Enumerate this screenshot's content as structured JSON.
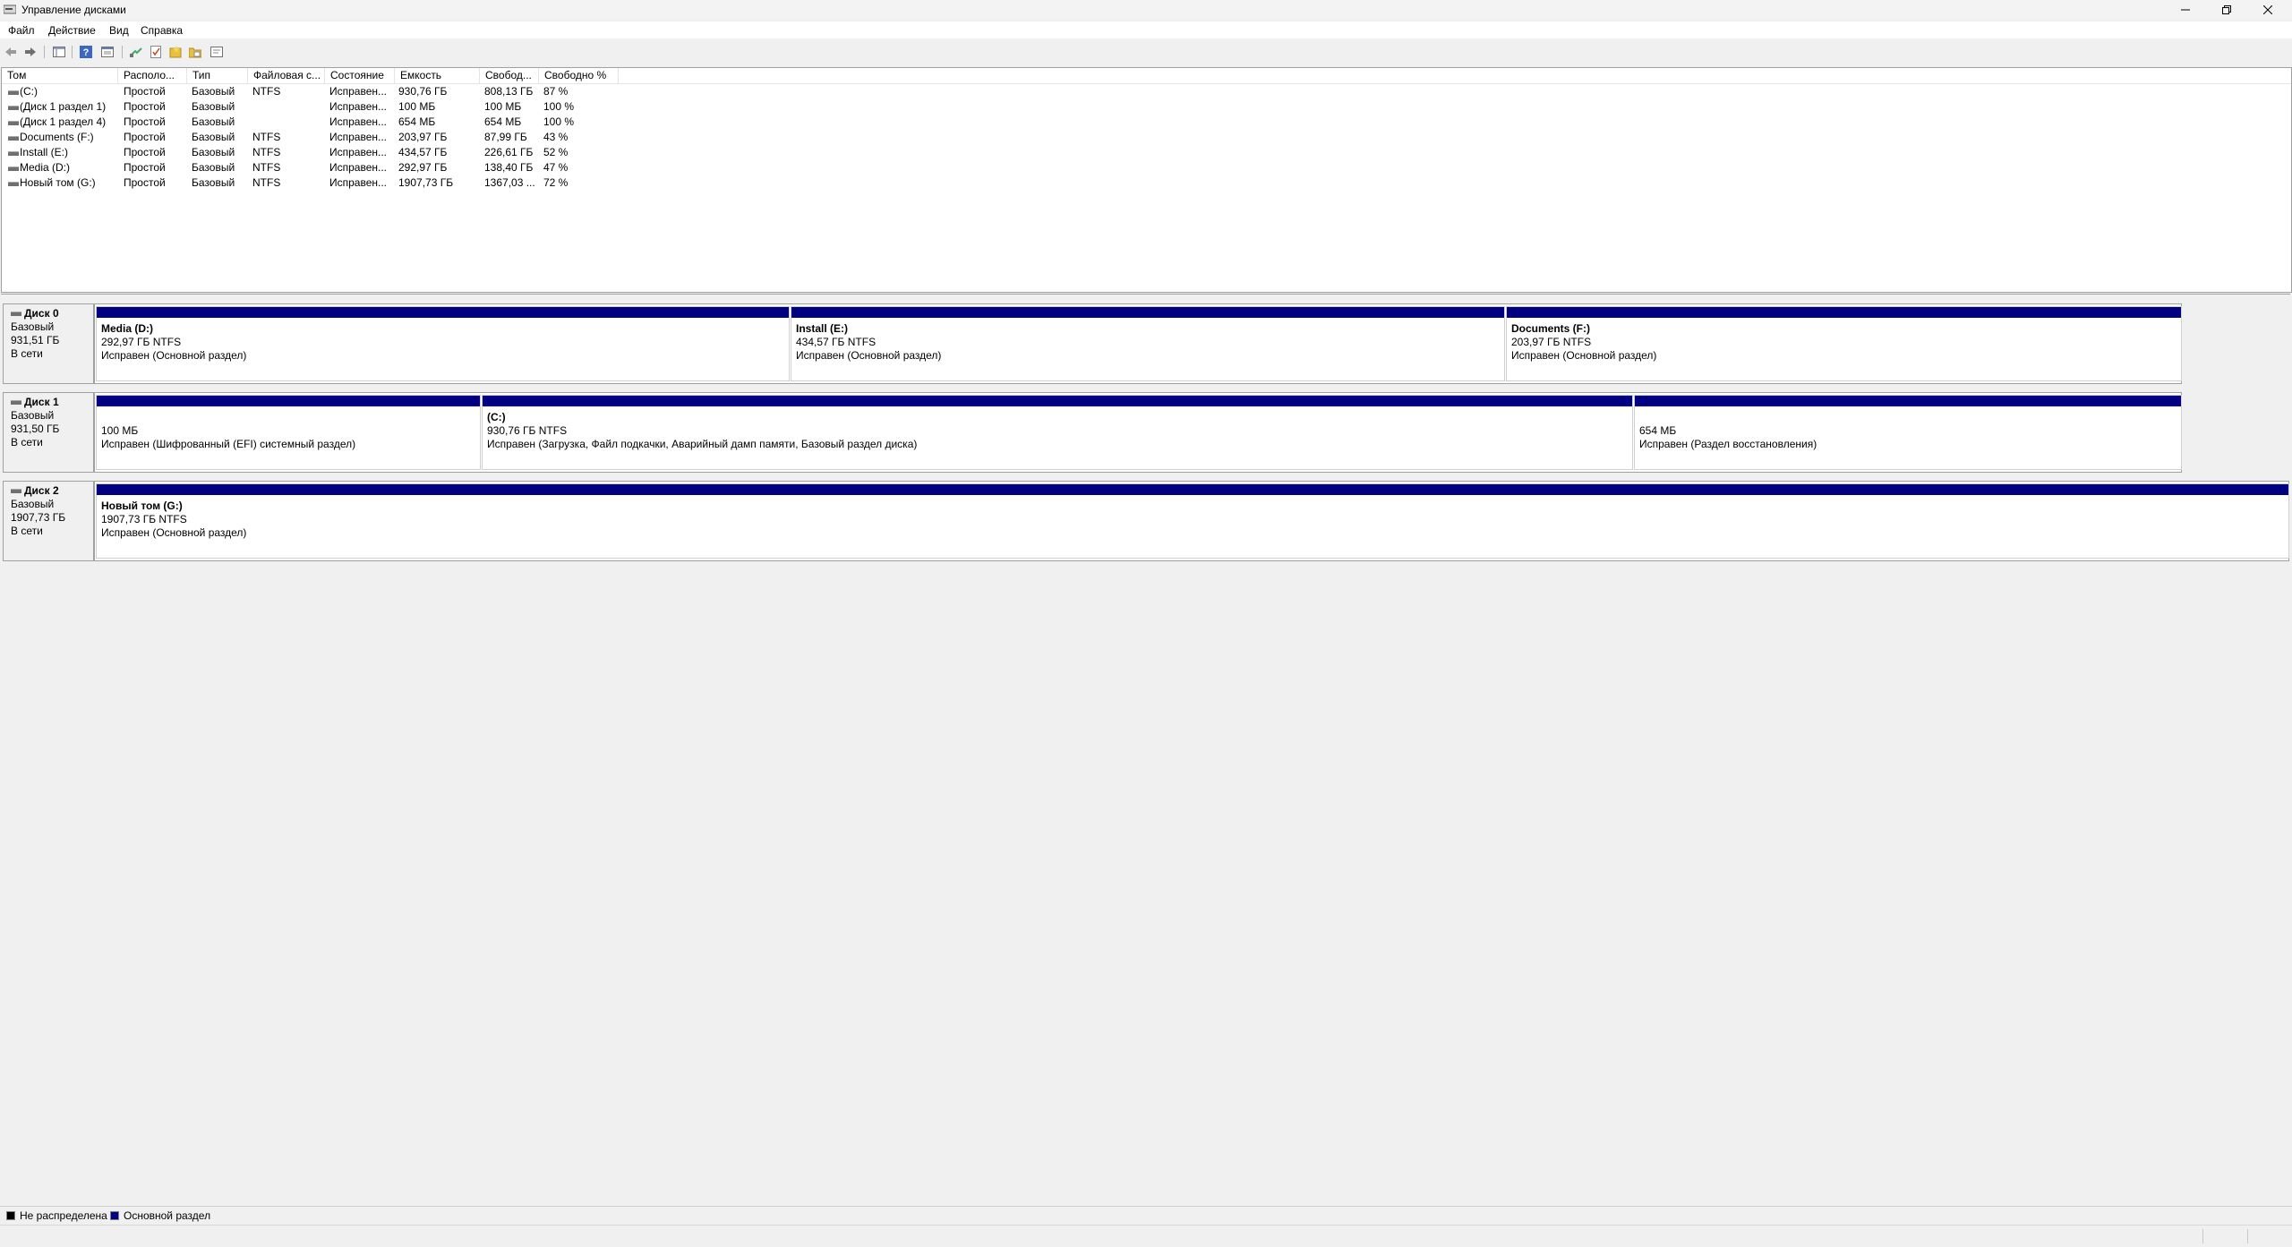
{
  "window": {
    "title": "Управление дисками"
  },
  "menu": [
    "Файл",
    "Действие",
    "Вид",
    "Справка"
  ],
  "toolbar": {
    "icons": [
      "back-icon",
      "forward-icon",
      "console-tree-icon",
      "help-icon",
      "properties-icon",
      "connect-icon",
      "check-icon",
      "new-icon",
      "folder-icon",
      "export-icon"
    ]
  },
  "volume_list": {
    "columns": [
      "Том",
      "Располо...",
      "Тип",
      "Файловая с...",
      "Состояние",
      "Емкость",
      "Свобод...",
      "Свободно %"
    ],
    "rows": [
      [
        "(C:)",
        "Простой",
        "Базовый",
        "NTFS",
        "Исправен...",
        "930,76 ГБ",
        "808,13 ГБ",
        "87 %"
      ],
      [
        "(Диск 1 раздел 1)",
        "Простой",
        "Базовый",
        "",
        "Исправен...",
        "100 МБ",
        "100 МБ",
        "100 %"
      ],
      [
        "(Диск 1 раздел 4)",
        "Простой",
        "Базовый",
        "",
        "Исправен...",
        "654 МБ",
        "654 МБ",
        "100 %"
      ],
      [
        "Documents (F:)",
        "Простой",
        "Базовый",
        "NTFS",
        "Исправен...",
        "203,97 ГБ",
        "87,99 ГБ",
        "43 %"
      ],
      [
        "Install (E:)",
        "Простой",
        "Базовый",
        "NTFS",
        "Исправен...",
        "434,57 ГБ",
        "226,61 ГБ",
        "52 %"
      ],
      [
        "Media (D:)",
        "Простой",
        "Базовый",
        "NTFS",
        "Исправен...",
        "292,97 ГБ",
        "138,40 ГБ",
        "47 %"
      ],
      [
        "Новый том (G:)",
        "Простой",
        "Базовый",
        "NTFS",
        "Исправен...",
        "1907,73 ГБ",
        "1367,03 ...",
        "72 %"
      ]
    ]
  },
  "disks": [
    {
      "name": "Диск 0",
      "type": "Базовый",
      "size": "931,51 ГБ",
      "status": "В сети",
      "partitions": [
        {
          "name": "Media  (D:)",
          "size": "292,97 ГБ NTFS",
          "status": "Исправен (Основной раздел)"
        },
        {
          "name": "Install  (E:)",
          "size": "434,57 ГБ NTFS",
          "status": "Исправен (Основной раздел)"
        },
        {
          "name": "Documents  (F:)",
          "size": "203,97 ГБ NTFS",
          "status": "Исправен (Основной раздел)"
        }
      ]
    },
    {
      "name": "Диск 1",
      "type": "Базовый",
      "size": "931,50 ГБ",
      "status": "В сети",
      "partitions": [
        {
          "name": "",
          "size": "100 МБ",
          "status": "Исправен (Шифрованный (EFI) системный раздел)"
        },
        {
          "name": "(C:)",
          "size": "930,76 ГБ NTFS",
          "status": "Исправен (Загрузка, Файл подкачки, Аварийный дамп памяти, Базовый раздел диска)"
        },
        {
          "name": "",
          "size": "654 МБ",
          "status": "Исправен (Раздел восстановления)"
        }
      ]
    },
    {
      "name": "Диск 2",
      "type": "Базовый",
      "size": "1907,73 ГБ",
      "status": "В сети",
      "partitions": [
        {
          "name": "Новый том  (G:)",
          "size": "1907,73 ГБ NTFS",
          "status": "Исправен (Основной раздел)"
        }
      ]
    }
  ],
  "legend": [
    {
      "label": "Не распределена",
      "color": "#000000"
    },
    {
      "label": "Основной раздел",
      "color": "#000080"
    }
  ]
}
